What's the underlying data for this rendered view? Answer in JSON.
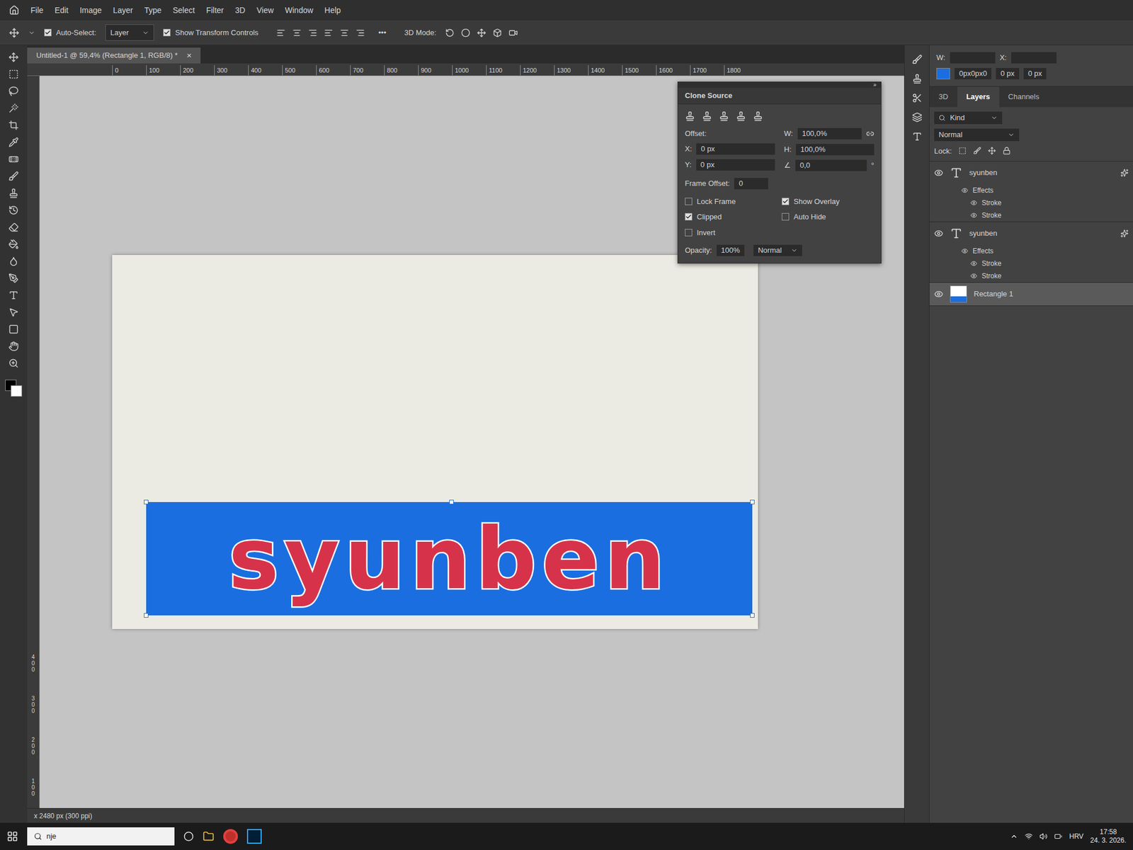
{
  "menu": [
    "File",
    "Edit",
    "Image",
    "Layer",
    "Type",
    "Select",
    "Filter",
    "3D",
    "View",
    "Window",
    "Help"
  ],
  "options": {
    "auto_select_label": "Auto-Select:",
    "auto_select_checked": true,
    "auto_select_value": "Layer",
    "transform_label": "Show Transform Controls",
    "transform_checked": true,
    "mode_label": "3D Mode:",
    "more": "•••"
  },
  "document_tab": {
    "title": "Untitled-1 @ 59,4% (Rectangle 1, RGB/8) *",
    "close": "×"
  },
  "ruler": {
    "horizontal": [
      "0",
      "100",
      "200",
      "300",
      "400",
      "500",
      "600",
      "700",
      "800",
      "900",
      "1000",
      "1100",
      "1200",
      "1300",
      "1400",
      "1500",
      "1600",
      "1700",
      "1800"
    ],
    "vertical": [
      "400",
      "300",
      "200",
      "100"
    ]
  },
  "canvas": {
    "banner_text": "syunben"
  },
  "clone_source": {
    "title": "Clone Source",
    "collapse": "»",
    "offset_label": "Offset:",
    "x_label": "X:",
    "x": "0 px",
    "y_label": "Y:",
    "y": "0 px",
    "w_label": "W:",
    "w": "100,0%",
    "h_label": "H:",
    "h": "100,0%",
    "angle_glyph": "∠",
    "angle": "0,0",
    "angle_unit": "°",
    "frame_offset_label": "Frame Offset:",
    "frame_offset": "0",
    "options": [
      {
        "label": "Lock Frame",
        "checked": false
      },
      {
        "label": "Show Overlay",
        "checked": true
      },
      {
        "label": "Clipped",
        "checked": true
      },
      {
        "label": "Auto Hide",
        "checked": false
      },
      {
        "label": "Invert",
        "checked": false
      }
    ],
    "opacity_label": "Opacity:",
    "opacity": "100%",
    "mode": "Normal"
  },
  "properties": {
    "w_label": "W:",
    "x_label": "X:",
    "value1": "0px0px0",
    "value2": "0 px",
    "value3": "0 px",
    "color": "#1a6ee0"
  },
  "layers_panel": {
    "tabs": [
      {
        "label": "3D",
        "selected": false
      },
      {
        "label": "Layers",
        "selected": true
      },
      {
        "label": "Channels",
        "selected": false
      }
    ],
    "kind": "Kind",
    "blend": "Normal",
    "lock_label": "Lock:",
    "layers": [
      {
        "name": "syunben",
        "kind": "text",
        "visible": true,
        "selected": false,
        "effects": [
          "Effects",
          "Stroke",
          "Stroke"
        ]
      },
      {
        "name": "syunben",
        "kind": "text",
        "visible": true,
        "selected": false,
        "effects": [
          "Effects",
          "Stroke",
          "Stroke"
        ]
      },
      {
        "name": "Rectangle 1",
        "kind": "shape",
        "visible": true,
        "selected": true,
        "effects": []
      }
    ]
  },
  "status_bar": "x 2480 px (300 ppi)",
  "taskbar": {
    "search_fragment": "nje",
    "language": "HRV",
    "time": "17:58",
    "date": "24. 3. 2026."
  }
}
